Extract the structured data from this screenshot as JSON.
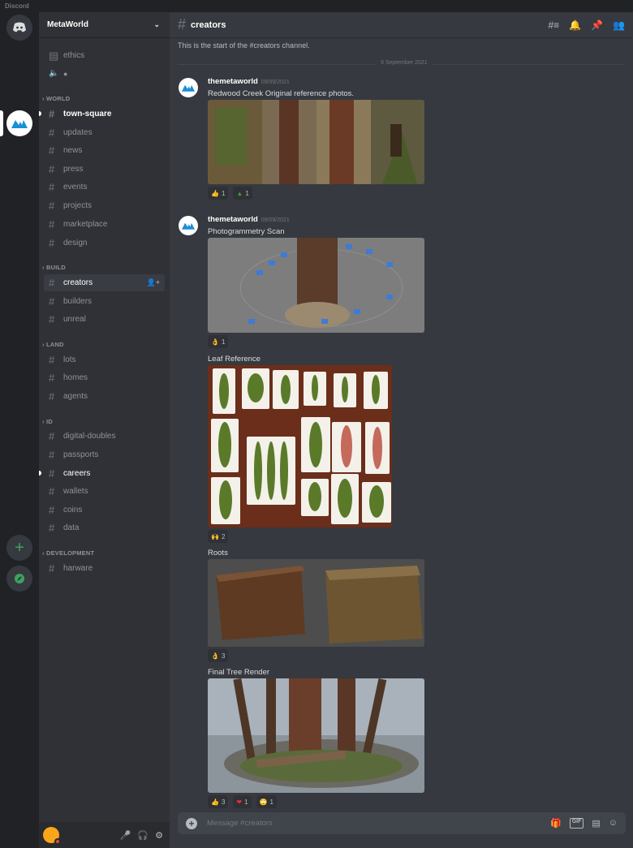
{
  "app": {
    "title": "Discord"
  },
  "server": {
    "name": "MetaWorld"
  },
  "sidebar": {
    "top_channels": [
      {
        "label": "ethics"
      }
    ],
    "categories": [
      {
        "label": "WORLD",
        "channels": [
          "town-square",
          "updates",
          "news",
          "press",
          "events",
          "projects",
          "marketplace",
          "design"
        ]
      },
      {
        "label": "BUILD",
        "channels": [
          "creators",
          "builders",
          "unreal"
        ]
      },
      {
        "label": "LAND",
        "channels": [
          "lots",
          "homes",
          "agents"
        ]
      },
      {
        "label": "ID",
        "channels": [
          "digital-doubles",
          "passports",
          "careers",
          "wallets",
          "coins",
          "data"
        ]
      },
      {
        "label": "DEVELOPMENT",
        "channels": [
          "harware"
        ]
      }
    ],
    "active_channel": "creators"
  },
  "channel": {
    "name": "creators",
    "start_text": "This is the start of the #creators channel.",
    "date_divider": "9 September 2021"
  },
  "messages": [
    {
      "author": "themetaworld",
      "timestamp": "09/09/2021",
      "text": "Redwood Creek Original reference photos.",
      "reactions": [
        {
          "emoji": "👍",
          "count": "1"
        },
        {
          "emoji": "▲",
          "count": "1"
        }
      ]
    },
    {
      "author": "themetaworld",
      "timestamp": "09/09/2021",
      "text": "Photogrammetry Scan",
      "reactions": [
        {
          "emoji": "👌",
          "count": "1"
        }
      ],
      "followups": [
        {
          "text": "Leaf Reference",
          "reactions": [
            {
              "emoji": "🙌",
              "count": "2"
            }
          ]
        },
        {
          "text": "Roots",
          "reactions": [
            {
              "emoji": "👌",
              "count": "3"
            }
          ]
        },
        {
          "text": "Final Tree Render",
          "reactions": [
            {
              "emoji": "👍",
              "count": "3"
            },
            {
              "emoji": "❤",
              "count": "1"
            },
            {
              "emoji": "🙄",
              "count": "1"
            }
          ]
        }
      ]
    }
  ],
  "composer": {
    "placeholder": "Message #creators",
    "gif_label": "GIF"
  },
  "colors": {
    "accent": "#5865f2",
    "online_green": "#3ba55d",
    "dnd_red": "#ed4245"
  }
}
